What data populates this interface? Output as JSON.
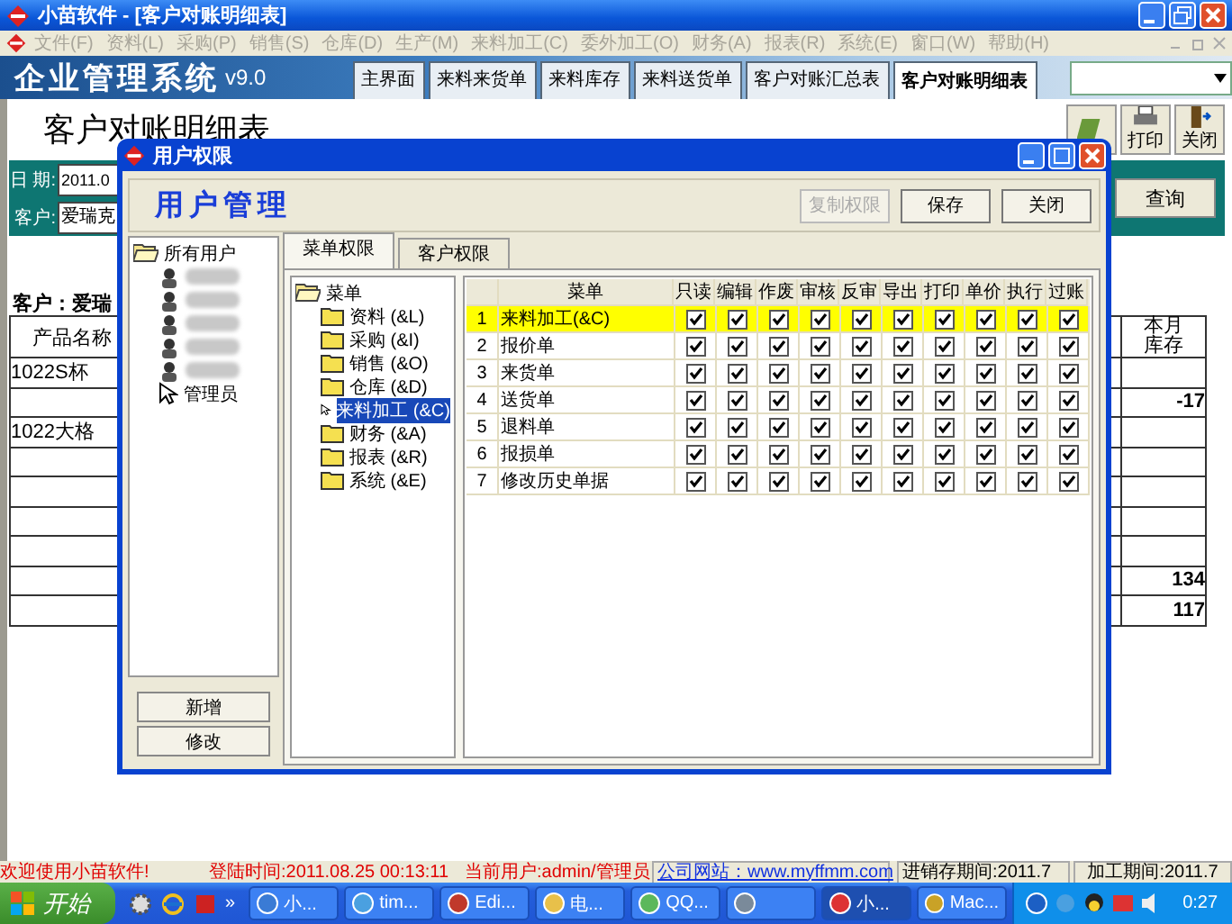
{
  "window": {
    "title": "小苗软件 - [客户对账明细表]"
  },
  "menu": [
    "文件(F)",
    "资料(L)",
    "采购(P)",
    "销售(S)",
    "仓库(D)",
    "生产(M)",
    "来料加工(C)",
    "委外加工(O)",
    "财务(A)",
    "报表(R)",
    "系统(E)",
    "窗口(W)",
    "帮助(H)"
  ],
  "banner": {
    "logo": "企业管理系统",
    "version": "v9.0",
    "tabs": [
      {
        "label": "主界面",
        "selected": false
      },
      {
        "label": "来料来货单",
        "selected": false
      },
      {
        "label": "来料库存",
        "selected": false
      },
      {
        "label": "来料送货单",
        "selected": false
      },
      {
        "label": "客户对账汇总表",
        "selected": false
      },
      {
        "label": "客户对账明细表",
        "selected": true
      }
    ]
  },
  "report": {
    "title": "客户对账明细表",
    "print": "打印",
    "close": "关闭",
    "date_label": "日 期:",
    "date_value": "2011.0",
    "customer_label": "客户:",
    "customer_value": "爱瑞克",
    "query": "查询",
    "customer_heading": "客户：爱瑞",
    "columns": [
      "产品名称",
      "本月库存"
    ],
    "rows": [
      {
        "product": "1022S杯"
      },
      {
        "stock": "-17"
      },
      {
        "product": "1022大格"
      },
      {},
      {},
      {},
      {},
      {
        "stock": "134"
      },
      {
        "stock": "117"
      }
    ]
  },
  "dialog": {
    "title": "用户权限",
    "heading": "用户管理",
    "buttons": [
      {
        "label": "复制权限",
        "disabled": true
      },
      {
        "label": "保存",
        "disabled": false
      },
      {
        "label": "关闭",
        "disabled": false
      }
    ],
    "user_tree": {
      "root": "所有用户",
      "children": [
        {
          "kind": "blurred"
        },
        {
          "kind": "blurred"
        },
        {
          "kind": "blurred"
        },
        {
          "kind": "blurred"
        },
        {
          "kind": "blurred"
        },
        {
          "kind": "named",
          "label": "管理员"
        }
      ]
    },
    "user_buttons": [
      "新增",
      "修改"
    ],
    "tabs": [
      {
        "label": "菜单权限",
        "selected": true
      },
      {
        "label": "客户权限",
        "selected": false
      }
    ],
    "menu_tree": {
      "root": "菜单",
      "children": [
        {
          "label": "资料 (&L)",
          "selected": false
        },
        {
          "label": "采购 (&I)",
          "selected": false
        },
        {
          "label": "销售 (&O)",
          "selected": false
        },
        {
          "label": "仓库 (&D)",
          "selected": false
        },
        {
          "label": "来料加工 (&C)",
          "selected": true
        },
        {
          "label": "财务 (&A)",
          "selected": false
        },
        {
          "label": "报表 (&R)",
          "selected": false
        },
        {
          "label": "系统 (&E)",
          "selected": false
        }
      ]
    },
    "grid": {
      "columns": [
        "菜单",
        "只读",
        "编辑",
        "作废",
        "审核",
        "反审",
        "导出",
        "打印",
        "单价",
        "执行",
        "过账"
      ],
      "rows": [
        {
          "no": "1",
          "menu": "来料加工(&C)",
          "selected": true,
          "checks": [
            true,
            true,
            true,
            true,
            true,
            true,
            true,
            true,
            true,
            true
          ]
        },
        {
          "no": "2",
          "menu": "报价单",
          "selected": false,
          "checks": [
            true,
            true,
            true,
            true,
            true,
            true,
            true,
            true,
            true,
            true
          ]
        },
        {
          "no": "3",
          "menu": "来货单",
          "selected": false,
          "checks": [
            true,
            true,
            true,
            true,
            true,
            true,
            true,
            true,
            true,
            true
          ]
        },
        {
          "no": "4",
          "menu": "送货单",
          "selected": false,
          "checks": [
            true,
            true,
            true,
            true,
            true,
            true,
            true,
            true,
            true,
            true
          ]
        },
        {
          "no": "5",
          "menu": "退料单",
          "selected": false,
          "checks": [
            true,
            true,
            true,
            true,
            true,
            true,
            true,
            true,
            true,
            true
          ]
        },
        {
          "no": "6",
          "menu": "报损单",
          "selected": false,
          "checks": [
            true,
            true,
            true,
            true,
            true,
            true,
            true,
            true,
            true,
            true
          ]
        },
        {
          "no": "7",
          "menu": "修改历史单据",
          "selected": false,
          "checks": [
            true,
            true,
            true,
            true,
            true,
            true,
            true,
            true,
            true,
            true
          ]
        }
      ]
    }
  },
  "status_bar": {
    "welcome": "欢迎使用小苗软件!",
    "login": "登陆时间:2011.08.25 00:13:11",
    "user": "当前用户:admin/管理员",
    "site": "公司网站：www.myffmm.com",
    "stock_period": "进销存期间:2011.7",
    "process_period": "加工期间:2011.7"
  },
  "taskbar": {
    "start": "开始",
    "more": "»",
    "tasks": [
      {
        "label": "小...",
        "selected": false
      },
      {
        "label": "tim...",
        "selected": false
      },
      {
        "label": "Edi...",
        "selected": false
      },
      {
        "label": "电...",
        "selected": false
      },
      {
        "label": "QQ...",
        "selected": false
      },
      {
        "selected": false
      },
      {
        "label": "小...",
        "selected": true
      },
      {
        "label": "Mac...",
        "selected": false
      }
    ],
    "clock": "0:27"
  }
}
